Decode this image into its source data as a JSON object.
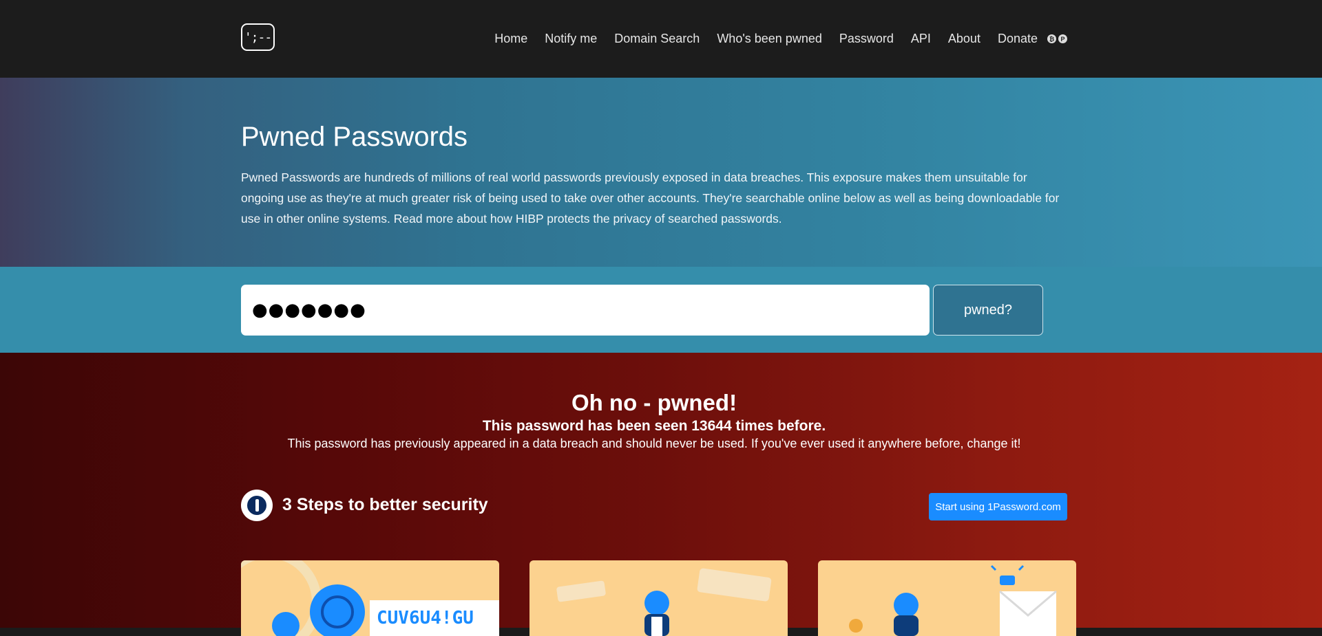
{
  "navbar": {
    "logo_text": "';--",
    "links": [
      "Home",
      "Notify me",
      "Domain Search",
      "Who's been pwned",
      "Password",
      "API",
      "About",
      "Donate"
    ],
    "donate_icons": [
      "bitcoin-icon",
      "paypal-icon"
    ],
    "donate_glyphs": [
      "₿",
      "P"
    ]
  },
  "hero": {
    "title": "Pwned Passwords",
    "description": "Pwned Passwords are hundreds of millions of real world passwords previously exposed in data breaches. This exposure makes them unsuitable for ongoing use as they're at much greater risk of being used to take over other accounts. They're searchable online below as well as being downloadable for use in other online systems. Read more about how HIBP protects the privacy of searched passwords."
  },
  "search": {
    "value": "●●●●●●●",
    "button_label": "pwned?"
  },
  "result": {
    "title": "Oh no - pwned!",
    "subtitle": "This password has been seen 13644 times before.",
    "description": "This password has previously appeared in a data breach and should never be used. If you've ever used it anywhere before, change it!",
    "steps_title": "3 Steps to better security",
    "cta_label": "Start using 1Password.com",
    "card1_code": "CUV6U4!GU"
  },
  "colors": {
    "navbar_bg": "#1c1c1c",
    "hero_accent": "#358eab",
    "danger": "#8d1a10",
    "cta": "#1a8cff",
    "card_bg": "#fcd28f"
  }
}
